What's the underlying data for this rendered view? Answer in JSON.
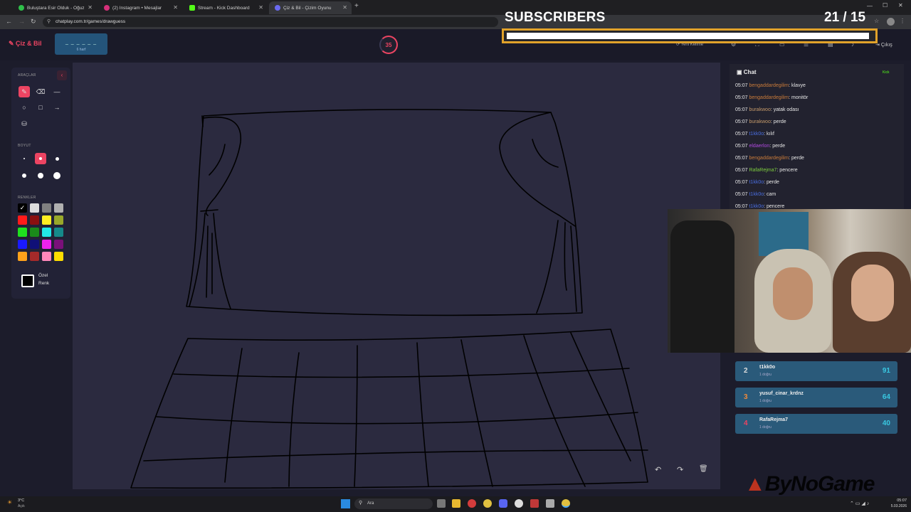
{
  "browser": {
    "tabs": [
      {
        "title": "Buluştara Esir Olduk - Oğuz",
        "color": "#2fbf4a"
      },
      {
        "title": "(2) Instagram • Mesajlar",
        "color": "#d6307a"
      },
      {
        "title": "Stream - Kick Dashboard",
        "color": "#53fc18"
      },
      {
        "title": "Çiz & Bil - Çizim Oyunu",
        "color": "#6a6af0"
      }
    ],
    "new_tab_symbol": "+",
    "url": "chatplay.com.tr/games/drawguess"
  },
  "app": {
    "logo": "Çiz & Bil",
    "word_hint": "_ _ _ _ _ _",
    "word_letters": "6 harf",
    "timer": "35",
    "next_word": "Yeni Kelime",
    "logout": "Çıkış"
  },
  "toolbox": {
    "tools_header": "ARAÇLAR",
    "size_header": "BOYUT",
    "colors_header": "RENKLER",
    "custom_color_line1": "Özel",
    "custom_color_line2": "Renk",
    "palette": [
      "#ffffff",
      "#dcdcdc",
      "#808080",
      "#b0b0b0",
      "#ff1a1a",
      "#8a1010",
      "#ffee22",
      "#98a82a",
      "#1fe01f",
      "#1a8a1a",
      "#22e8e8",
      "#158a8a",
      "#1a1aff",
      "#101078",
      "#ee22ee",
      "#7a107a",
      "#ffa21a",
      "#a52a2a",
      "#ff88bb",
      "#ffdd00"
    ]
  },
  "chat": {
    "title": "Chat",
    "platform": "Kick",
    "messages": [
      {
        "time": "05:07",
        "user": "bengaddardegilim",
        "color": "#c97b3a",
        "text": "klavye"
      },
      {
        "time": "05:07",
        "user": "bengaddardegilim",
        "color": "#c97b3a",
        "text": "monitör"
      },
      {
        "time": "05:07",
        "user": "burakwoo",
        "color": "#c59a6a",
        "text": "yatak odası"
      },
      {
        "time": "05:07",
        "user": "burakwoo",
        "color": "#c59a6a",
        "text": "perde"
      },
      {
        "time": "05:07",
        "user": "t1kk0o",
        "color": "#4a6ee0",
        "text": "kılıf"
      },
      {
        "time": "05:07",
        "user": "eldaerlon",
        "color": "#b04adf",
        "text": "perde"
      },
      {
        "time": "05:07",
        "user": "bengaddardegilim",
        "color": "#c97b3a",
        "text": "perde"
      },
      {
        "time": "05:07",
        "user": "RafaRejma7",
        "color": "#7ecf3e",
        "text": "pencere"
      },
      {
        "time": "05:07",
        "user": "t1kk0o",
        "color": "#4a6ee0",
        "text": "perde"
      },
      {
        "time": "05:07",
        "user": "t1kk0o",
        "color": "#4a6ee0",
        "text": "cam"
      },
      {
        "time": "05:07",
        "user": "t1kk0o",
        "color": "#4a6ee0",
        "text": "pencere"
      }
    ]
  },
  "leaderboard": [
    {
      "rank": "2",
      "rank_color": "#dddddd",
      "name": "t1kk0o",
      "sub": "1 doğru",
      "score": "91"
    },
    {
      "rank": "3",
      "rank_color": "#f08a3a",
      "name": "yusuf_cinar_krdnz",
      "sub": "1 doğru",
      "score": "64"
    },
    {
      "rank": "4",
      "rank_color": "#ec4462",
      "name": "RafaRejma7",
      "sub": "1 doğru",
      "score": "40"
    }
  ],
  "overlay": {
    "subs_label": "SUBSCRIBERS",
    "subs_count": "21",
    "subs_goal": "/ 15",
    "subs_progress": 0.99,
    "watermark": "ByNoGame"
  },
  "taskbar": {
    "weather": "3°C",
    "weather_sub": "Açık",
    "search": "Ara",
    "time": "05:07",
    "date": "5.03.2026"
  }
}
